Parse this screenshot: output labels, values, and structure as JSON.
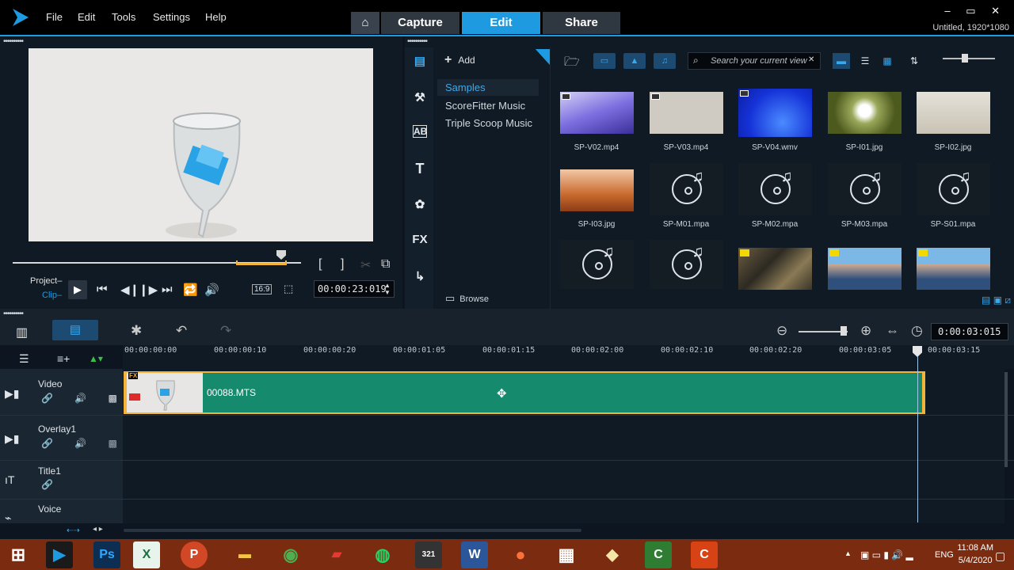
{
  "menu": [
    "File",
    "Edit",
    "Tools",
    "Settings",
    "Help"
  ],
  "workspace_tabs": {
    "capture": "Capture",
    "edit": "Edit",
    "share": "Share"
  },
  "title_info": "Untitled, 1920*1080",
  "window_controls": "– ▭ ✕",
  "player": {
    "project_label": "Project–",
    "clip_label": "Clip–",
    "aspect": "16:9",
    "timecode": "00:00:23:019",
    "trim_in": "[",
    "trim_out": "]"
  },
  "library": {
    "add_label": "Add",
    "folders": [
      "Samples",
      "ScoreFitter Music",
      "Triple Scoop Music"
    ],
    "selected_folder": "Samples",
    "browse_label": "Browse",
    "search_placeholder": "Search your current view",
    "items": [
      {
        "name": "SP-V02.mp4",
        "kind": "video"
      },
      {
        "name": "SP-V03.mp4",
        "kind": "video"
      },
      {
        "name": "SP-V04.wmv",
        "kind": "video"
      },
      {
        "name": "SP-I01.jpg",
        "kind": "image"
      },
      {
        "name": "SP-I02.jpg",
        "kind": "image"
      },
      {
        "name": "SP-I03.jpg",
        "kind": "image"
      },
      {
        "name": "SP-M01.mpa",
        "kind": "audio"
      },
      {
        "name": "SP-M02.mpa",
        "kind": "audio"
      },
      {
        "name": "SP-M03.mpa",
        "kind": "audio"
      },
      {
        "name": "SP-S01.mpa",
        "kind": "audio"
      },
      {
        "name": "",
        "kind": "audio"
      },
      {
        "name": "",
        "kind": "audio"
      },
      {
        "name": "",
        "kind": "project"
      },
      {
        "name": "",
        "kind": "project"
      },
      {
        "name": "",
        "kind": "project"
      }
    ]
  },
  "timeline": {
    "timecode": "0:00:03:015",
    "ruler": [
      "00:00:00:00",
      "00:00:00:10",
      "00:00:00:20",
      "00:00:01:05",
      "00:00:01:15",
      "00:00:02:00",
      "00:00:02:10",
      "00:00:02:20",
      "00:00:03:05",
      "00:00:03:15"
    ],
    "tracks": [
      "Video",
      "Overlay1",
      "Title1",
      "Voice"
    ],
    "clip_name": "00088.MTS",
    "clip_fx": "FX"
  },
  "taskbar": {
    "time": "11:08 AM",
    "date": "5/4/2020",
    "lang": "ENG"
  },
  "colors": {
    "accent": "#1e9be0",
    "clip": "#168a6d",
    "trim": "#f2b43a"
  }
}
